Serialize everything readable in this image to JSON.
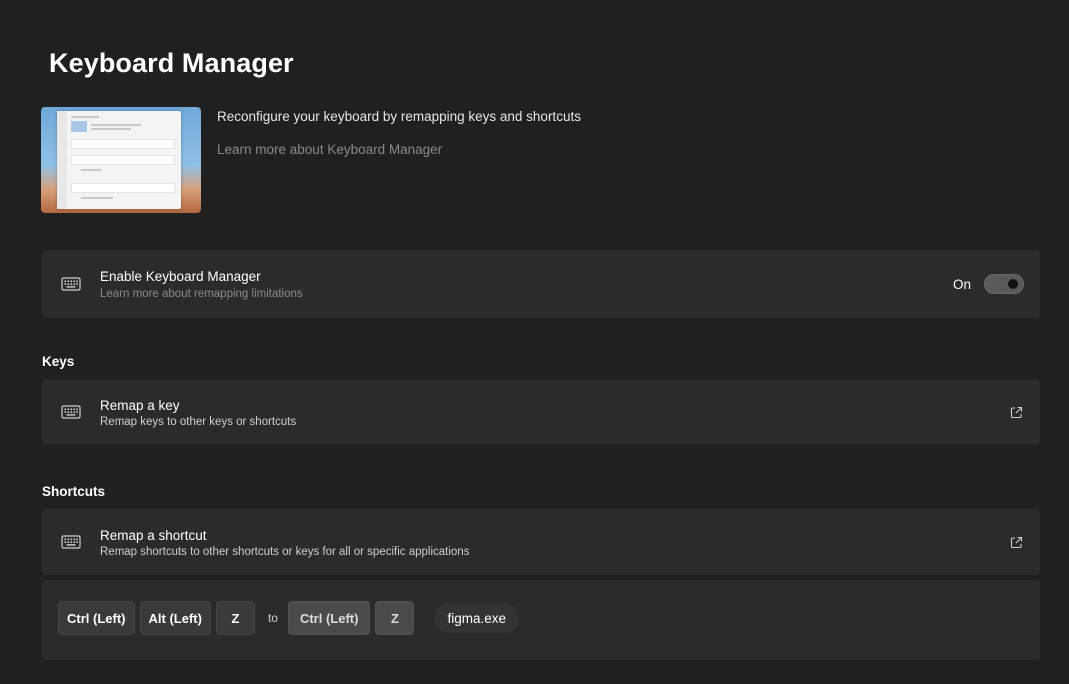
{
  "page": {
    "title": "Keyboard Manager"
  },
  "hero": {
    "description": "Reconfigure your keyboard by remapping keys and shortcuts",
    "learn_more": "Learn more about Keyboard Manager"
  },
  "enable": {
    "title": "Enable Keyboard Manager",
    "subtitle": "Learn more about remapping limitations",
    "toggle_label": "On",
    "toggle_on": true,
    "icon": "keyboard-icon"
  },
  "keys_section": {
    "header": "Keys",
    "remap_key": {
      "title": "Remap a key",
      "subtitle": "Remap keys to other keys or shortcuts",
      "icon": "keyboard-icon",
      "action_icon": "open-external-icon"
    }
  },
  "shortcuts_section": {
    "header": "Shortcuts",
    "remap_shortcut": {
      "title": "Remap a shortcut",
      "subtitle": "Remap shortcuts to other shortcuts or keys for all or specific applications",
      "icon": "keyboard-icon",
      "action_icon": "open-external-icon"
    },
    "mapping": {
      "from": [
        "Ctrl (Left)",
        "Alt (Left)",
        "Z"
      ],
      "to_label": "to",
      "to": [
        "Ctrl (Left)",
        "Z"
      ],
      "app": "figma.exe"
    }
  },
  "colors": {
    "background": "#202020",
    "card": "#2b2b2b",
    "link": "#8a8a8a"
  }
}
